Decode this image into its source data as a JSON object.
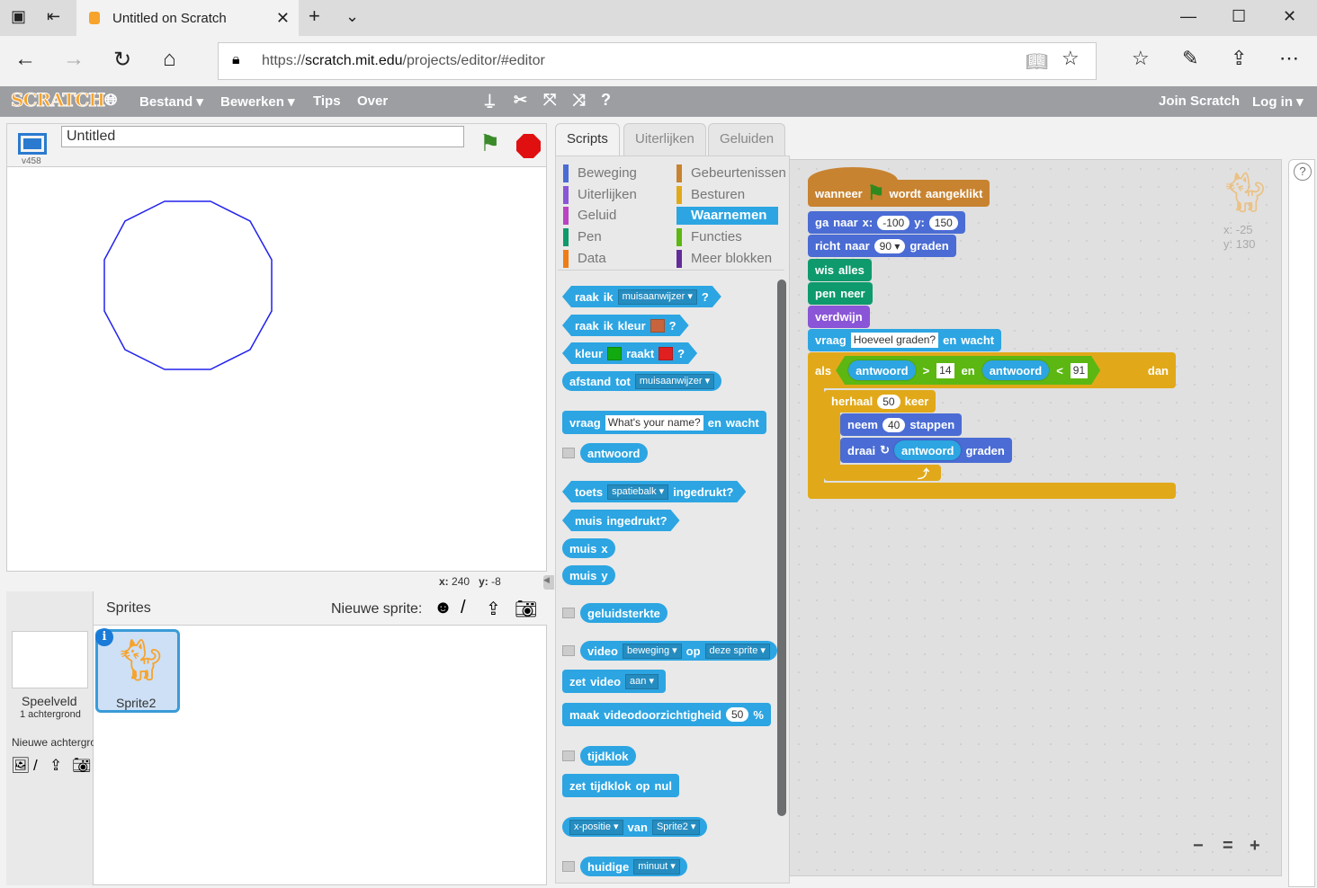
{
  "browser": {
    "tab_title": "Untitled on Scratch",
    "url_prefix": "https://",
    "url_host": "scratch.mit.edu",
    "url_path": "/projects/editor/#editor"
  },
  "menubar": {
    "logo": "SCRATCH",
    "items": [
      "Bestand ▾",
      "Bewerken ▾",
      "Tips",
      "Over"
    ],
    "join": "Join Scratch",
    "login": "Log in ▾"
  },
  "stage": {
    "title": "Untitled",
    "version": "v458",
    "x_label": "x:",
    "x": "240",
    "y_label": "y:",
    "y": "-8",
    "pen_color": "#2222ee"
  },
  "sprites_pane": {
    "header": "Sprites",
    "new_sprite": "Nieuwe sprite:",
    "stage_label": "Speelveld",
    "backdrop_count": "1 achtergrond",
    "new_backdrop": "Nieuwe achtergrond",
    "sprite_name": "Sprite2"
  },
  "tabs": [
    "Scripts",
    "Uiterlijken",
    "Geluiden"
  ],
  "categories": [
    {
      "label": "Beweging",
      "color": "#4a6cd4"
    },
    {
      "label": "Gebeurtenissen",
      "color": "#c88330"
    },
    {
      "label": "Uiterlijken",
      "color": "#8a55d7"
    },
    {
      "label": "Besturen",
      "color": "#e1a91a"
    },
    {
      "label": "Geluid",
      "color": "#bb42c3"
    },
    {
      "label": "Waarnemen",
      "color": "#2ca5e2",
      "selected": true
    },
    {
      "label": "Pen",
      "color": "#0e9a6c"
    },
    {
      "label": "Functies",
      "color": "#5cb712"
    },
    {
      "label": "Data",
      "color": "#ee7d16"
    },
    {
      "label": "Meer blokken",
      "color": "#632d99"
    }
  ],
  "palette": [
    {
      "shape": "hex",
      "parts": [
        [
          "t",
          "raak"
        ],
        [
          "t",
          "ik"
        ],
        [
          "d",
          "muisaanwijzer ▾"
        ],
        [
          "t",
          "?"
        ]
      ]
    },
    {
      "shape": "hex",
      "parts": [
        [
          "t",
          "raak"
        ],
        [
          "t",
          "ik"
        ],
        [
          "t",
          "kleur"
        ],
        [
          "c",
          "#c8643c"
        ],
        [
          "t",
          "?"
        ]
      ]
    },
    {
      "shape": "hex",
      "parts": [
        [
          "t",
          "kleur"
        ],
        [
          "c",
          "#11aa11"
        ],
        [
          "t",
          "raakt"
        ],
        [
          "c",
          "#e02020"
        ],
        [
          "t",
          "?"
        ]
      ]
    },
    {
      "shape": "rep",
      "parts": [
        [
          "t",
          "afstand"
        ],
        [
          "t",
          "tot"
        ],
        [
          "d",
          "muisaanwijzer ▾"
        ]
      ]
    },
    {
      "shape": "stack",
      "parts": [
        [
          "t",
          "vraag"
        ],
        [
          "s",
          "What's your name?"
        ],
        [
          "t",
          "en"
        ],
        [
          "t",
          "wacht"
        ]
      ]
    },
    {
      "shape": "rep",
      "check": true,
      "parts": [
        [
          "t",
          "antwoord"
        ]
      ]
    },
    {
      "shape": "hex",
      "parts": [
        [
          "t",
          "toets"
        ],
        [
          "d",
          "spatiebalk ▾"
        ],
        [
          "t",
          "ingedrukt?"
        ]
      ]
    },
    {
      "shape": "hex",
      "parts": [
        [
          "t",
          "muis"
        ],
        [
          "t",
          "ingedrukt?"
        ]
      ]
    },
    {
      "shape": "rep",
      "parts": [
        [
          "t",
          "muis"
        ],
        [
          "t",
          "x"
        ]
      ]
    },
    {
      "shape": "rep",
      "parts": [
        [
          "t",
          "muis"
        ],
        [
          "t",
          "y"
        ]
      ]
    },
    {
      "shape": "rep",
      "check": true,
      "parts": [
        [
          "t",
          "geluidsterkte"
        ]
      ]
    },
    {
      "shape": "rep",
      "check": true,
      "parts": [
        [
          "t",
          "video"
        ],
        [
          "d",
          "beweging ▾"
        ],
        [
          "t",
          "op"
        ],
        [
          "d",
          "deze sprite ▾"
        ]
      ]
    },
    {
      "shape": "stack",
      "parts": [
        [
          "t",
          "zet"
        ],
        [
          "t",
          "video"
        ],
        [
          "d",
          "aan ▾"
        ]
      ]
    },
    {
      "shape": "stack",
      "parts": [
        [
          "t",
          "maak"
        ],
        [
          "t",
          "videodoorzichtigheid"
        ],
        [
          "n",
          "50"
        ],
        [
          "t",
          "%"
        ]
      ]
    },
    {
      "shape": "rep",
      "check": true,
      "parts": [
        [
          "t",
          "tijdklok"
        ]
      ]
    },
    {
      "shape": "stack",
      "parts": [
        [
          "t",
          "zet"
        ],
        [
          "t",
          "tijdklok"
        ],
        [
          "t",
          "op"
        ],
        [
          "t",
          "nul"
        ]
      ]
    },
    {
      "shape": "rep",
      "parts": [
        [
          "d",
          "x-positie ▾"
        ],
        [
          "t",
          "van"
        ],
        [
          "d",
          "Sprite2 ▾"
        ]
      ]
    },
    {
      "shape": "rep",
      "check": true,
      "parts": [
        [
          "t",
          "huidige"
        ],
        [
          "d",
          "minuut ▾"
        ]
      ]
    }
  ],
  "script": [
    {
      "cat": "#c88330",
      "parts": [
        [
          "t",
          "wanneer"
        ],
        [
          "f",
          ""
        ],
        [
          "t",
          "wordt"
        ],
        [
          "t",
          "aangeklikt"
        ]
      ]
    },
    {
      "cat": "#4a6cd4",
      "parts": [
        [
          "t",
          "ga"
        ],
        [
          "t",
          "naar"
        ],
        [
          "t",
          "x:"
        ],
        [
          "n",
          "-100"
        ],
        [
          "t",
          "y:"
        ],
        [
          "n",
          "150"
        ]
      ]
    },
    {
      "cat": "#4a6cd4",
      "parts": [
        [
          "t",
          "richt"
        ],
        [
          "t",
          "naar"
        ],
        [
          "n",
          "90 ▾"
        ],
        [
          "t",
          "graden"
        ]
      ]
    },
    {
      "cat": "#0e9a6c",
      "parts": [
        [
          "t",
          "wis"
        ],
        [
          "t",
          "alles"
        ]
      ]
    },
    {
      "cat": "#0e9a6c",
      "parts": [
        [
          "t",
          "pen"
        ],
        [
          "t",
          "neer"
        ]
      ]
    },
    {
      "cat": "#8a55d7",
      "parts": [
        [
          "t",
          "verdwijn"
        ]
      ]
    },
    {
      "cat": "#2ca5e2",
      "parts": [
        [
          "t",
          "vraag"
        ],
        [
          "s",
          "Hoeveel graden?"
        ],
        [
          "t",
          "en"
        ],
        [
          "t",
          "wacht"
        ]
      ]
    },
    {
      "cat": "#e1a91a",
      "parts": [
        [
          "t",
          "als"
        ],
        [
          "b",
          [
            [
              "r",
              "antwoord"
            ],
            [
              "t",
              ">"
            ],
            [
              "s",
              "14"
            ],
            [
              "t",
              "en"
            ],
            [
              "r",
              "antwoord"
            ],
            [
              "t",
              "<"
            ],
            [
              "s",
              "91"
            ]
          ]
        ],
        [
          "t",
          "dan"
        ]
      ]
    },
    {
      "cat": "#e1a91a",
      "parts": [
        [
          "t",
          "herhaal"
        ],
        [
          "n",
          "50"
        ],
        [
          "t",
          "keer"
        ]
      ]
    },
    {
      "cat": "#4a6cd4",
      "parts": [
        [
          "t",
          "neem"
        ],
        [
          "n",
          "40"
        ],
        [
          "t",
          "stappen"
        ]
      ]
    },
    {
      "cat": "#4a6cd4",
      "parts": [
        [
          "t",
          "draai"
        ],
        [
          "t",
          "↻"
        ],
        [
          "r",
          "antwoord"
        ],
        [
          "t",
          "graden"
        ]
      ]
    },
    {
      "cat": "#e1a91a",
      "parts": [
        [
          "t",
          "⤴"
        ]
      ]
    }
  ],
  "sprite_info": {
    "x_label": "x:",
    "x": "-25",
    "y_label": "y:",
    "y": "130"
  },
  "zoom_controls": {
    "zoom_out": "−",
    "reset": "=",
    "zoom_in": "+"
  }
}
